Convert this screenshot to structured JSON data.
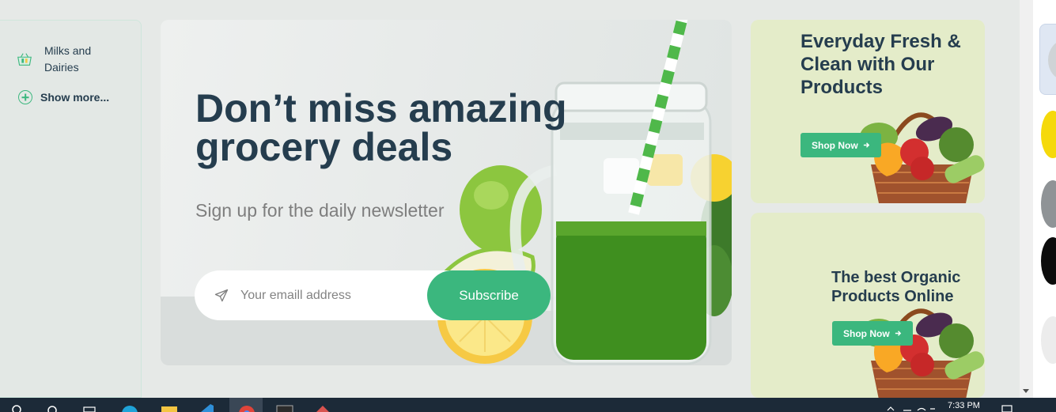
{
  "sidebar": {
    "category": {
      "label": "Milks and Dairies",
      "icon": "milk-basket-icon"
    },
    "show_more": {
      "label": "Show more...",
      "icon": "plus-circle-icon"
    }
  },
  "hero": {
    "title": "Don’t miss amazing grocery deals",
    "subtitle": "Sign up for the daily newsletter",
    "newsletter": {
      "placeholder": "Your emaill address",
      "button_label": "Subscribe",
      "icon": "send-icon"
    }
  },
  "banners": [
    {
      "title": "Everyday Fresh & Clean with Our Products",
      "button_label": "Shop Now",
      "button_icon": "arrow-right-icon"
    },
    {
      "title": "The best Organic Products Online",
      "button_label": "Shop Now",
      "button_icon": "arrow-right-icon"
    }
  ],
  "taskbar": {
    "time": "7:33 PM"
  },
  "colors": {
    "brand_green": "#3bb77e",
    "heading": "#253d4e",
    "muted_text": "#7e7e7e",
    "banner_bg": "#e4ecc9",
    "taskbar": "#1c2a38"
  }
}
